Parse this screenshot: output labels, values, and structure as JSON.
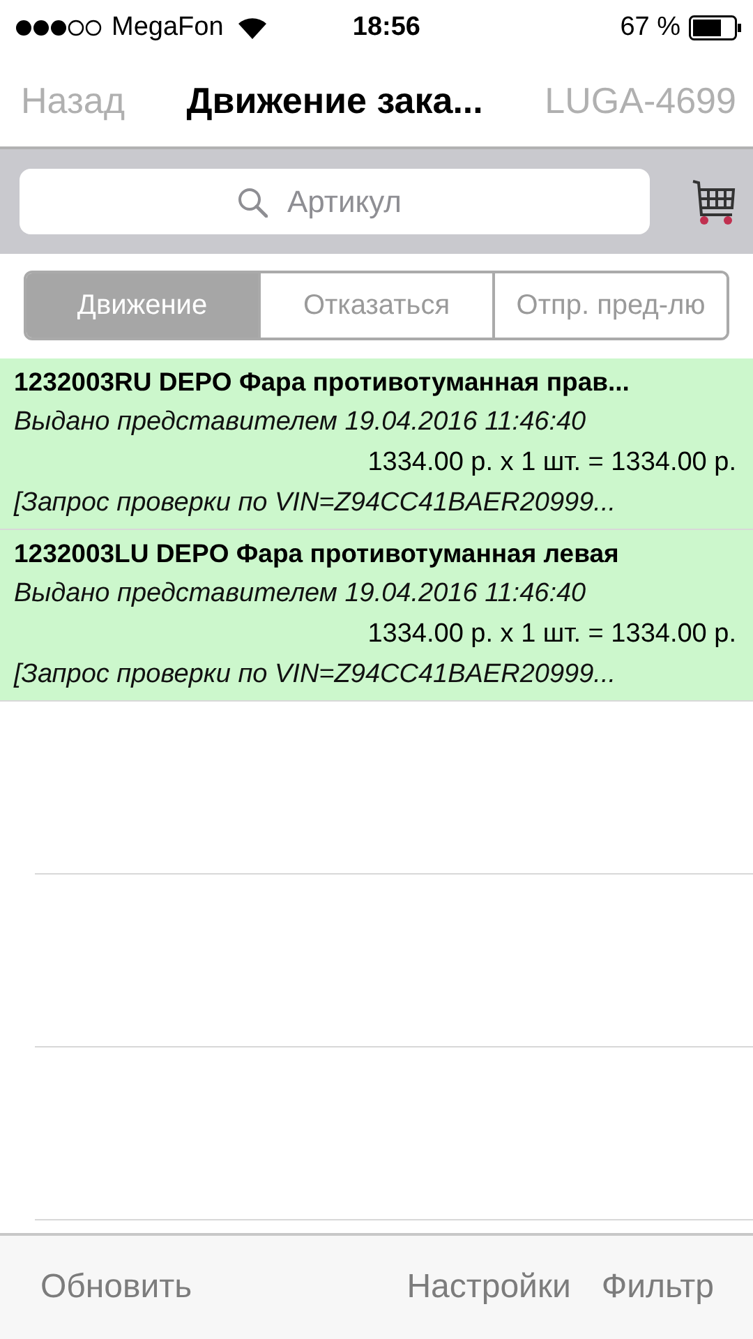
{
  "status_bar": {
    "carrier": "MegaFon",
    "time": "18:56",
    "battery": "67 %"
  },
  "nav": {
    "back": "Назад",
    "title": "Движение зака...",
    "right": "LUGA-4699"
  },
  "search": {
    "placeholder": "Артикул"
  },
  "segments": [
    {
      "label": "Движение",
      "selected": true
    },
    {
      "label": "Отказаться",
      "selected": false
    },
    {
      "label": "Отпр. пред-лю",
      "selected": false
    }
  ],
  "rows": [
    {
      "title": "1232003RU DEPO Фара противотуманная прав...",
      "status": "Выдано представителем 19.04.2016 11:46:40",
      "price": "1334.00 р. x 1 шт. =  1334.00 р.",
      "note": "[Запрос проверки по VIN=Z94CC41BAER20999..."
    },
    {
      "title": "1232003LU DEPO Фара противотуманная левая",
      "status": "Выдано представителем 19.04.2016 11:46:40",
      "price": "1334.00 р. x 1 шт. =  1334.00 р.",
      "note": "[Запрос проверки по VIN=Z94CC41BAER20999..."
    }
  ],
  "toolbar": [
    "Обновить",
    "Настройки",
    "Фильтр"
  ]
}
